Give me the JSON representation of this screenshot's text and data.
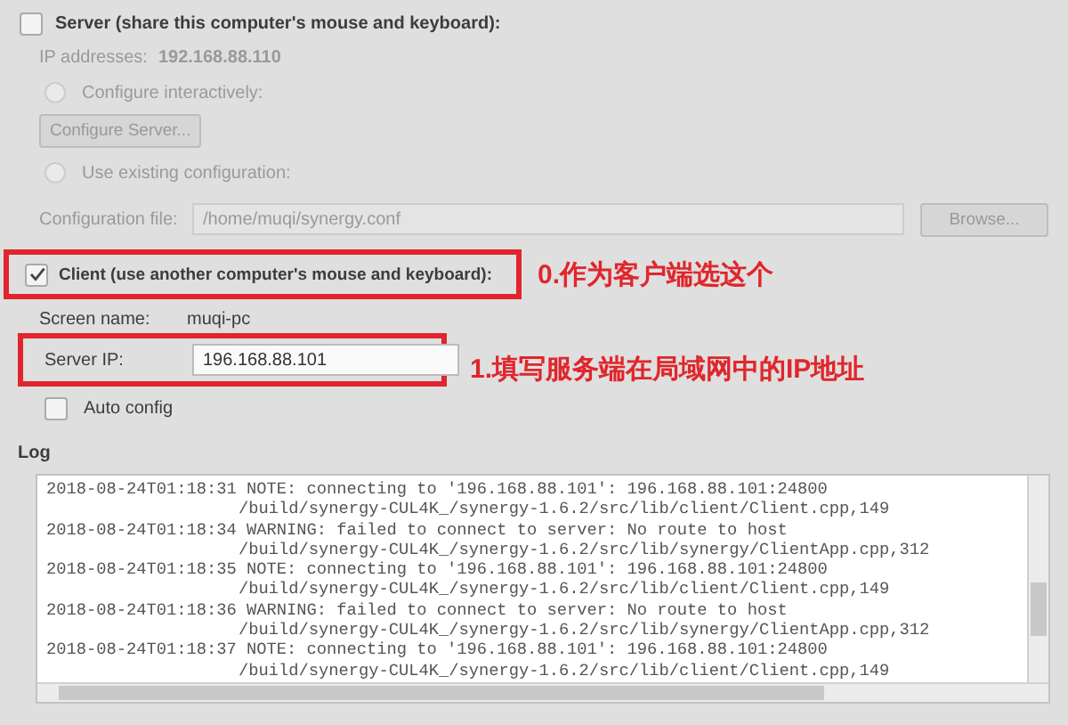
{
  "server": {
    "label": "Server (share this computer's mouse and keyboard):",
    "checked": false,
    "disabled": true,
    "ip_label": "IP addresses:",
    "ip_value": "192.168.88.110",
    "options": [
      {
        "label": "Configure interactively:",
        "selected": false
      },
      {
        "label": "Use existing configuration:",
        "selected": false
      }
    ],
    "configure_button": "Configure Server...",
    "config_file": {
      "label": "Configuration file:",
      "value": "/home/muqi/synergy.conf",
      "browse_button": "Browse..."
    }
  },
  "client": {
    "label": "Client (use another computer's mouse and keyboard):",
    "checked": true,
    "screen_name_label": "Screen name:",
    "screen_name": "muqi-pc",
    "server_ip_label": "Server IP:",
    "server_ip": "196.168.88.101",
    "auto_config": {
      "label": "Auto config",
      "checked": false
    }
  },
  "annotations": [
    "0.作为客户端选这个",
    "1.填写服务端在局域网中的IP地址"
  ],
  "log": {
    "title": "Log",
    "entries": [
      {
        "message": "2018-08-24T01:18:31 NOTE: connecting to '196.168.88.101': 196.168.88.101:24800",
        "source": "/build/synergy-CUL4K_/synergy-1.6.2/src/lib/client/Client.cpp,149"
      },
      {
        "message": "2018-08-24T01:18:34 WARNING: failed to connect to server: No route to host",
        "source": "/build/synergy-CUL4K_/synergy-1.6.2/src/lib/synergy/ClientApp.cpp,312"
      },
      {
        "message": "2018-08-24T01:18:35 NOTE: connecting to '196.168.88.101': 196.168.88.101:24800",
        "source": "/build/synergy-CUL4K_/synergy-1.6.2/src/lib/client/Client.cpp,149"
      },
      {
        "message": "2018-08-24T01:18:36 WARNING: failed to connect to server: No route to host",
        "source": "/build/synergy-CUL4K_/synergy-1.6.2/src/lib/synergy/ClientApp.cpp,312"
      },
      {
        "message": "2018-08-24T01:18:37 NOTE: connecting to '196.168.88.101': 196.168.88.101:24800",
        "source": "/build/synergy-CUL4K_/synergy-1.6.2/src/lib/client/Client.cpp,149"
      }
    ]
  }
}
